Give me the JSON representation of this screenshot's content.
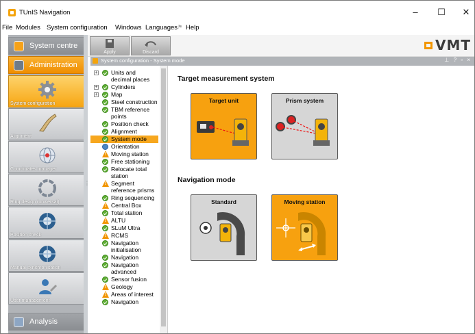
{
  "window": {
    "title": "TUnIS Navigation",
    "controls": {
      "minimize": "–",
      "maximize": "☐",
      "close": "✕"
    }
  },
  "menu": [
    "File",
    "Modules",
    "System configuration",
    "Windows",
    "Languages",
    "Help"
  ],
  "sidebar": {
    "sections": [
      {
        "label": "System centre"
      },
      {
        "label": "Administration"
      },
      {
        "label": "Analysis"
      }
    ],
    "tools": [
      {
        "label": "System configuration",
        "icon": "gear-icon",
        "active": true
      },
      {
        "label": "Alignment",
        "icon": "alignment-icon",
        "active": false
      },
      {
        "label": "Coordinates manager",
        "icon": "globe-icon",
        "active": false
      },
      {
        "label": "Ring design (universal)",
        "icon": "ring-icon",
        "active": false
      },
      {
        "label": "Position check",
        "icon": "tunnel-ring-icon",
        "active": false
      },
      {
        "label": "Manual synchronisation",
        "icon": "tunnel-ring-icon",
        "active": false
      },
      {
        "label": "User management",
        "icon": "users-icon",
        "active": false
      }
    ]
  },
  "toolbar": {
    "apply_label": "Apply",
    "discard_label": "Discard",
    "logo_text": "VMT"
  },
  "document": {
    "title": "System configuration - System mode",
    "title_buttons": "⊥ ? ▫ ×"
  },
  "tree": [
    {
      "lines": [
        "Units and",
        "decimal places"
      ],
      "status": "ok",
      "expander": "+"
    },
    {
      "lines": [
        "Cylinders"
      ],
      "status": "ok",
      "expander": "+"
    },
    {
      "lines": [
        "Map"
      ],
      "status": "ok",
      "expander": "+"
    },
    {
      "lines": [
        "Steel construction"
      ],
      "status": "ok"
    },
    {
      "lines": [
        "TBM reference",
        "points"
      ],
      "status": "ok"
    },
    {
      "lines": [
        "Position check"
      ],
      "status": "ok"
    },
    {
      "lines": [
        "Alignment"
      ],
      "status": "ok"
    },
    {
      "lines": [
        "System mode"
      ],
      "status": "ok",
      "selected": true
    },
    {
      "lines": [
        "Orientation"
      ],
      "status": "blue"
    },
    {
      "lines": [
        "Moving station"
      ],
      "status": "warn"
    },
    {
      "lines": [
        "Free stationing"
      ],
      "status": "ok"
    },
    {
      "lines": [
        "Relocate total",
        "station"
      ],
      "status": "ok"
    },
    {
      "lines": [
        "Segment",
        "reference prisms"
      ],
      "status": "warn"
    },
    {
      "lines": [
        "Ring sequencing"
      ],
      "status": "ok"
    },
    {
      "lines": [
        "Central Box"
      ],
      "status": "warn"
    },
    {
      "lines": [
        "Total station"
      ],
      "status": "ok"
    },
    {
      "lines": [
        "ALTU"
      ],
      "status": "warn"
    },
    {
      "lines": [
        "SLuM Ultra"
      ],
      "status": "ok"
    },
    {
      "lines": [
        "RCMS"
      ],
      "status": "warn"
    },
    {
      "lines": [
        "Navigation",
        "initialisation"
      ],
      "status": "ok"
    },
    {
      "lines": [
        "Navigation"
      ],
      "status": "ok"
    },
    {
      "lines": [
        "Navigation",
        "advanced"
      ],
      "status": "ok"
    },
    {
      "lines": [
        "Sensor fusion"
      ],
      "status": "ok"
    },
    {
      "lines": [
        "Geology"
      ],
      "status": "warn"
    },
    {
      "lines": [
        "Areas of interest"
      ],
      "status": "warn"
    },
    {
      "lines": [
        "Navigation"
      ],
      "status": "ok"
    }
  ],
  "main": {
    "target_section": {
      "title": "Target measurement system",
      "options": [
        {
          "label": "Target unit",
          "selected": true
        },
        {
          "label": "Prism system",
          "selected": false
        }
      ]
    },
    "navigation_section": {
      "title": "Navigation mode",
      "options": [
        {
          "label": "Standard",
          "selected": false
        },
        {
          "label": "Moving station",
          "selected": true
        }
      ]
    }
  },
  "colors": {
    "accent": "#f7a10f",
    "sidebar": "#b1b4b8",
    "ok": "#5fae34",
    "warn": "#f19400"
  }
}
